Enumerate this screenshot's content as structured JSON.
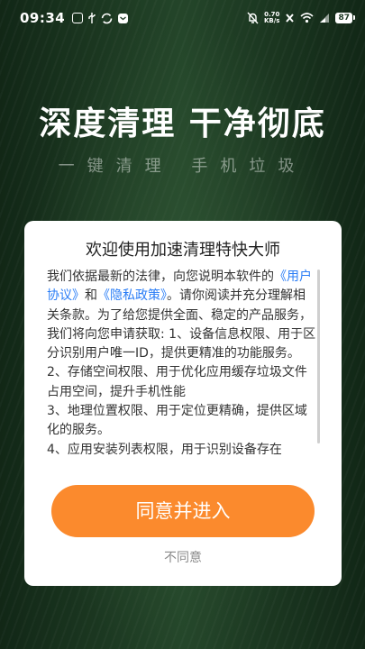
{
  "status_bar": {
    "time": "09:34",
    "net_speed_value": "0.70",
    "net_speed_unit": "KB/s",
    "battery": "87",
    "icons": [
      "notification-square-icon",
      "usb-icon",
      "sync-icon",
      "message-icon",
      "mute-bell-icon",
      "no-sim-icon",
      "wifi-icon",
      "signal-icon",
      "battery-icon"
    ]
  },
  "background": {
    "headline": "深度清理 干净彻底",
    "subline": "一键清理  手机垃圾"
  },
  "dialog": {
    "title": "欢迎使用加速清理特快大师",
    "body": {
      "p1": "我们依据最新的法律，向您说明本软件的",
      "link_user_agreement": "《用户协议》",
      "and": "和",
      "link_privacy_policy": "《隐私政策》",
      "p2": "。请你阅读并充分理解相关条款。为了给您提供全面、稳定的产品服务，我们将向您申请获取: 1、设备信息权限、用于区分识别用户唯一ID，提供更精准的功能服务。",
      "p3": "2、存储空间权限、用于优化应用缓存垃圾文件占用空间，提升手机性能",
      "p4": "3、地理位置权限、用于定位更精确，提供区域化的服务。",
      "p5": "4、应用安装列表权限，用于识别设备存在"
    },
    "agree_label": "同意并进入",
    "disagree_label": "不同意"
  },
  "colors": {
    "accent_button": "#fb8a2d",
    "link": "#2a7df6",
    "background": "#1f3a25"
  }
}
